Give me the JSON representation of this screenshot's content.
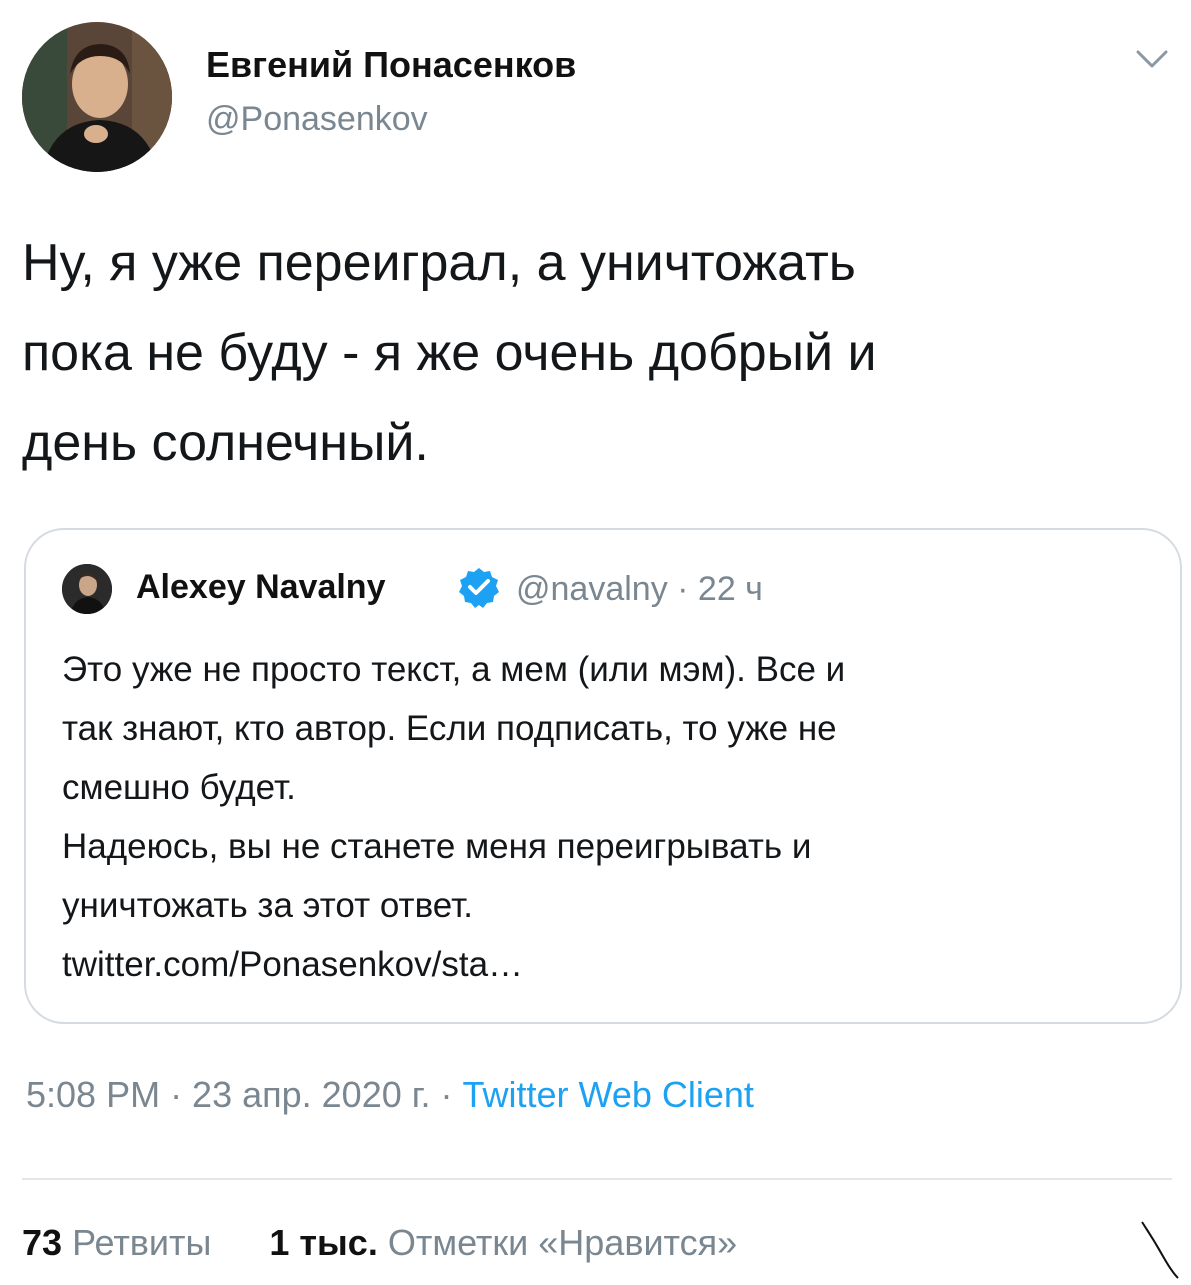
{
  "author": {
    "display_name": "Евгений Понасенков",
    "username": "@Ponasenkov"
  },
  "tweet": {
    "text_lines": [
      "Ну, я уже переиграл, а уничтожать",
      "пока не буду - я же очень добрый и",
      "день солнечный."
    ]
  },
  "quote": {
    "display_name": "Alexey Navalny",
    "handle_time": "@navalny · 22 ч",
    "lines": [
      "Это уже не просто текст, а мем (или мэм). Все и",
      "так знают, кто автор. Если подписать, то уже не",
      "смешно будет.",
      "Надеюсь, вы не станете меня переигрывать и",
      "уничтожать за этот ответ."
    ],
    "link": "twitter.com/Ponasenkov/sta…"
  },
  "meta": {
    "time_date": "5:08 PM · 23 апр. 2020 г. · ",
    "client": "Twitter Web Client"
  },
  "stats": {
    "retweets_count": "73",
    "retweets_label": "Ретвиты",
    "likes_count": "1 тыс.",
    "likes_label": "Отметки «Нравится»"
  },
  "colors": {
    "link_blue": "#1da1f2",
    "secondary_text": "#7a8791",
    "border": "#d5dbe0"
  },
  "icons": [
    "chevron-down-icon",
    "verified-badge-icon"
  ]
}
